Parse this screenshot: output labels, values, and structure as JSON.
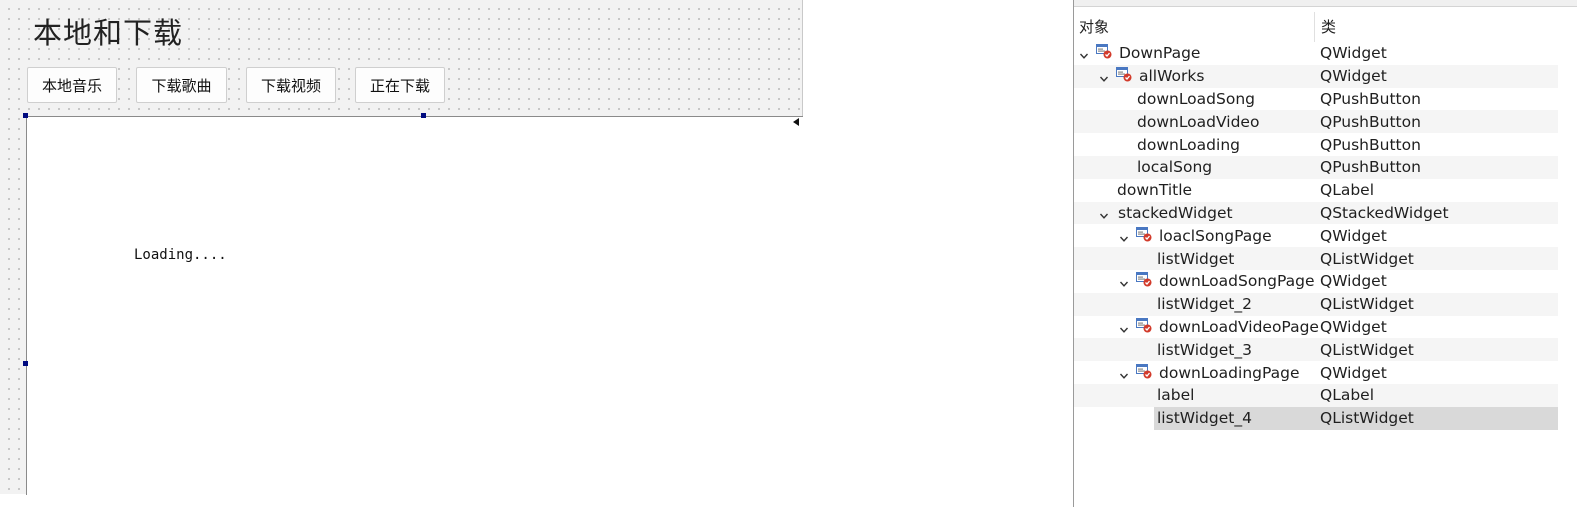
{
  "form": {
    "title": "本地和下载",
    "buttons": [
      "本地音乐",
      "下载歌曲",
      "下载视频",
      "正在下载"
    ],
    "stack_label": "Loading...."
  },
  "inspector": {
    "col_object": "对象",
    "col_class": "类",
    "rows": [
      {
        "object": "DownPage",
        "class": "QWidget",
        "level": 0,
        "expand": true,
        "icon": "widget-icon"
      },
      {
        "object": "allWorks",
        "class": "QWidget",
        "level": 1,
        "expand": true,
        "icon": "widget-icon"
      },
      {
        "object": "downLoadSong",
        "class": "QPushButton",
        "level": 2,
        "expand": false,
        "icon": ""
      },
      {
        "object": "downLoadVideo",
        "class": "QPushButton",
        "level": 2,
        "expand": false,
        "icon": ""
      },
      {
        "object": "downLoading",
        "class": "QPushButton",
        "level": 2,
        "expand": false,
        "icon": ""
      },
      {
        "object": "localSong",
        "class": "QPushButton",
        "level": 2,
        "expand": false,
        "icon": ""
      },
      {
        "object": "downTitle",
        "class": "QLabel",
        "level": 1,
        "expand": false,
        "icon": ""
      },
      {
        "object": "stackedWidget",
        "class": "QStackedWidget",
        "level": 1,
        "expand": true,
        "icon": ""
      },
      {
        "object": "loaclSongPage",
        "class": "QWidget",
        "level": 2,
        "expand": true,
        "icon": "widget-icon"
      },
      {
        "object": "listWidget",
        "class": "QListWidget",
        "level": 3,
        "expand": false,
        "icon": ""
      },
      {
        "object": "downLoadSongPage",
        "class": "QWidget",
        "level": 2,
        "expand": true,
        "icon": "widget-icon"
      },
      {
        "object": "listWidget_2",
        "class": "QListWidget",
        "level": 3,
        "expand": false,
        "icon": ""
      },
      {
        "object": "downLoadVideoPage",
        "class": "QWidget",
        "level": 2,
        "expand": true,
        "icon": "widget-icon"
      },
      {
        "object": "listWidget_3",
        "class": "QListWidget",
        "level": 3,
        "expand": false,
        "icon": ""
      },
      {
        "object": "downLoadingPage",
        "class": "QWidget",
        "level": 2,
        "expand": true,
        "icon": "widget-icon"
      },
      {
        "object": "label",
        "class": "QLabel",
        "level": 3,
        "expand": false,
        "icon": ""
      },
      {
        "object": "listWidget_4",
        "class": "QListWidget",
        "level": 3,
        "expand": false,
        "icon": "",
        "selected": true
      }
    ]
  },
  "colors": {
    "handle": "#000a80",
    "selection": "#d9d9d9",
    "widget_icon_blue": "#4a78c2",
    "widget_icon_red": "#d23a2a"
  }
}
